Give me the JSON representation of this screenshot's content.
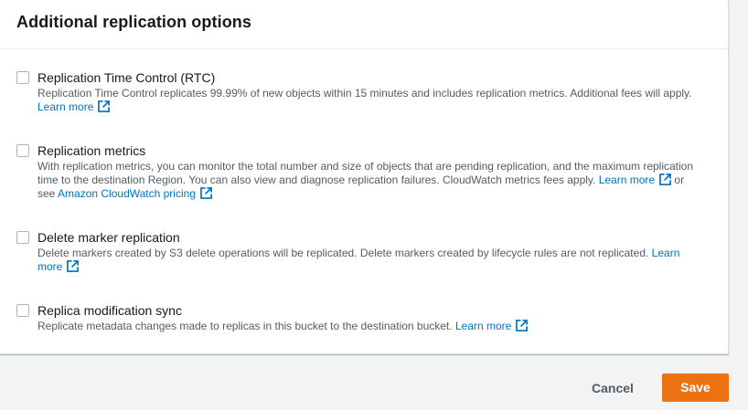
{
  "panel": {
    "title": "Additional replication options"
  },
  "options": [
    {
      "label": "Replication Time Control (RTC)",
      "description": "Replication Time Control replicates 99.99% of new objects within 15 minutes and includes replication metrics. Additional fees will apply.",
      "link": "Learn more",
      "checked": false
    },
    {
      "label": "Replication metrics",
      "description": "With replication metrics, you can monitor the total number and size of objects that are pending replication, and the maximum replication time to the destination Region. You can also view and diagnose replication failures. CloudWatch metrics fees apply.",
      "link": "Learn more",
      "connector": "or see",
      "link2": "Amazon CloudWatch pricing",
      "checked": false
    },
    {
      "label": "Delete marker replication",
      "description": "Delete markers created by S3 delete operations will be replicated. Delete markers created by lifecycle rules are not replicated.",
      "link": "Learn more",
      "checked": false
    },
    {
      "label": "Replica modification sync",
      "description": "Replicate metadata changes made to replicas in this bucket to the destination bucket.",
      "link": "Learn more",
      "checked": false
    }
  ],
  "footer": {
    "cancel_label": "Cancel",
    "save_label": "Save"
  },
  "colors": {
    "accent": "#ec7211",
    "link": "#0073bb",
    "text": "#16191f",
    "muted": "#545b64"
  },
  "icons": {
    "external_link": "external-link-icon"
  }
}
